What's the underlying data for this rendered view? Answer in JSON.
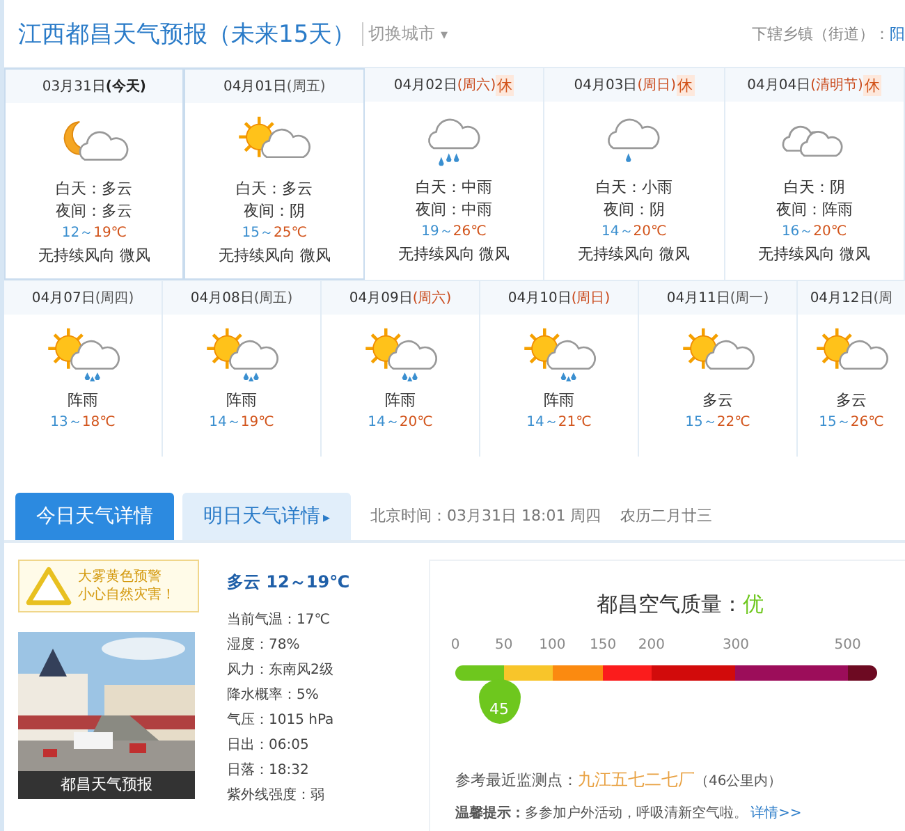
{
  "header": {
    "title": "江西都昌天气预报（未来15天）",
    "switch_city": "切换城市",
    "caret": "▾",
    "towns_label": "下辖乡镇（街道）：",
    "towns_link": "阳"
  },
  "forecast_rows": [
    {
      "days": [
        {
          "kind": "detailed",
          "date": "03月31日",
          "weekday": "(今天)",
          "today": true,
          "weekend": false,
          "day": "白天：多云",
          "night": "夜间：多云",
          "low": "12～",
          "high": "19℃",
          "wind": "无持续风向 微风"
        },
        {
          "kind": "detailed",
          "date": "04月01日",
          "weekday": "(周五)",
          "today": false,
          "weekend": false,
          "day": "白天：多云",
          "night": "夜间：阴",
          "low": "15～",
          "high": "25℃",
          "wind": "无持续风向 微风"
        },
        {
          "kind": "detailed",
          "date": "04月02日",
          "weekday": "(周六)",
          "today": false,
          "weekend": true,
          "rest": "休",
          "day": "白天：中雨",
          "night": "夜间：中雨",
          "low": "19～",
          "high": "26℃",
          "wind": "无持续风向 微风"
        },
        {
          "kind": "detailed",
          "date": "04月03日",
          "weekday": "(周日)",
          "today": false,
          "weekend": true,
          "rest": "休",
          "day": "白天：小雨",
          "night": "夜间：阴",
          "low": "14～",
          "high": "20℃",
          "wind": "无持续风向 微风"
        },
        {
          "kind": "detailed",
          "date": "04月04日",
          "weekday": "(清明节)",
          "today": false,
          "weekend": true,
          "rest": "休",
          "day": "白天：阴",
          "night": "夜间：阵雨",
          "low": "16～",
          "high": "20℃",
          "wind": "无持续风向 微风"
        }
      ]
    },
    {
      "days": [
        {
          "kind": "brief",
          "date": "04月07日",
          "weekday": "(周四)",
          "today": false,
          "weekend": false,
          "summary": "阵雨",
          "low": "13～",
          "high": "18℃"
        },
        {
          "kind": "brief",
          "date": "04月08日",
          "weekday": "(周五)",
          "today": false,
          "weekend": false,
          "summary": "阵雨",
          "low": "14～",
          "high": "19℃"
        },
        {
          "kind": "brief",
          "date": "04月09日",
          "weekday": "(周六)",
          "today": false,
          "weekend": true,
          "summary": "阵雨",
          "low": "14～",
          "high": "20℃"
        },
        {
          "kind": "brief",
          "date": "04月10日",
          "weekday": "(周日)",
          "today": false,
          "weekend": true,
          "summary": "阵雨",
          "low": "14～",
          "high": "21℃"
        },
        {
          "kind": "brief",
          "date": "04月11日",
          "weekday": "(周一)",
          "today": false,
          "weekend": false,
          "summary": "多云",
          "low": "15～",
          "high": "22℃"
        },
        {
          "kind": "brief",
          "date": "04月12日",
          "weekday": "(周",
          "today": false,
          "weekend": false,
          "summary": "多云",
          "low": "15～",
          "high": "26℃"
        }
      ]
    }
  ],
  "detail_tabs": [
    {
      "label": "今日天气详情",
      "selected": true
    },
    {
      "label": "明日天气详情",
      "selected": false,
      "arrow": "▸"
    }
  ],
  "clock": {
    "time": "北京时间：03月31日 18:01 周四",
    "lunar": "农历二月廿三"
  },
  "warning": {
    "line1": "大雾黄色预警",
    "line2": "小心自然灾害！"
  },
  "photo": {
    "kind": "picture",
    "caption": "都昌天气预报"
  },
  "today": {
    "headline": "多云 12～19℃",
    "lines": [
      "当前气温：17℃",
      "湿度：78%",
      "风力：东南风2级",
      "降水概率：5%",
      "气压：1015 hPa",
      "日出：06:05",
      "日落：18:32",
      "紫外线强度：弱"
    ]
  },
  "air": {
    "title": "都昌空气质量：",
    "grade": "优",
    "ticks": [
      "0",
      "50",
      "100",
      "150",
      "200",
      "300",
      "500"
    ],
    "segments": [
      {
        "color": "#6ec71e"
      },
      {
        "color": "#f8c52a"
      },
      {
        "color": "#fb8a10"
      },
      {
        "color": "#fb1c1c"
      },
      {
        "color": "#d20b0b"
      },
      {
        "color": "#9c0d5a"
      },
      {
        "color": "#6d0a22"
      }
    ],
    "marker": {
      "value": "45",
      "level": 0.104
    },
    "station_label": "参考最近监测点：",
    "station": "九江五七二七厂",
    "distance": "（46公里内）",
    "tip": "**温馨提示：**多参加户外活动，呼吸清新空气啦。",
    "tip_link": "详情>>"
  }
}
